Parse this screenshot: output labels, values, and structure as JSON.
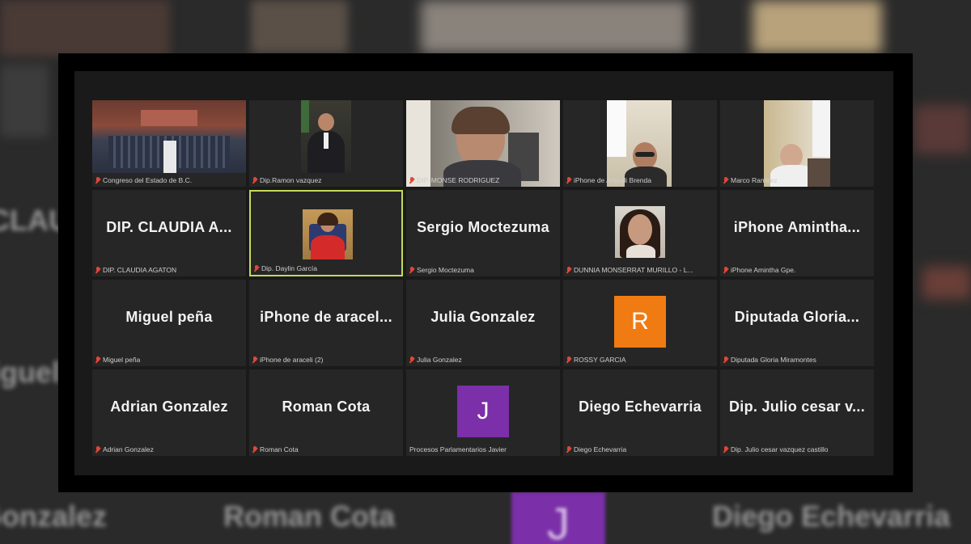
{
  "background": {
    "names": [
      "CLAUD",
      "Miguel",
      "Adrian Gonzalez",
      "Roman Cota",
      "Diego Echevarria"
    ]
  },
  "participants": [
    {
      "label": "Congreso del Estado de B.C.",
      "display_name": "",
      "type": "video-chamber"
    },
    {
      "label": "Dip.Ramon vazquez",
      "display_name": "",
      "type": "video-man"
    },
    {
      "label": "DIP. MONSE RODRIGUEZ",
      "display_name": "",
      "type": "video-woman"
    },
    {
      "label": "iPhone de Araceli Brenda",
      "display_name": "",
      "type": "video-woman2"
    },
    {
      "label": "Marco Ramirez",
      "display_name": "",
      "type": "video-man2"
    },
    {
      "label": "DIP. CLAUDIA AGATON",
      "display_name": "DIP. CLAUDIA A...",
      "type": "name"
    },
    {
      "label": "Dip. Daylin García",
      "display_name": "",
      "type": "video-daylin",
      "active": true
    },
    {
      "label": "Sergio Moctezuma",
      "display_name": "Sergio Moctezuma",
      "type": "name"
    },
    {
      "label": "DUNNIA MONSERRAT MURILLO - L...",
      "display_name": "",
      "type": "video-dunnia"
    },
    {
      "label": "iPhone Amintha Gpe.",
      "display_name": "iPhone Amintha...",
      "type": "name"
    },
    {
      "label": "Miguel peña",
      "display_name": "Miguel peña",
      "type": "name"
    },
    {
      "label": "iPhone de araceli (2)",
      "display_name": "iPhone de aracel...",
      "type": "name"
    },
    {
      "label": "Julia Gonzalez",
      "display_name": "Julia Gonzalez",
      "type": "name"
    },
    {
      "label": "ROSSY GARCIA",
      "display_name": "",
      "type": "avatar",
      "avatar_letter": "R",
      "avatar_color": "#f07b12"
    },
    {
      "label": "Diputada Gloria Miramontes",
      "display_name": "Diputada Gloria...",
      "type": "name"
    },
    {
      "label": "Adrian Gonzalez",
      "display_name": "Adrian Gonzalez",
      "type": "name"
    },
    {
      "label": "Roman Cota",
      "display_name": "Roman Cota",
      "type": "name"
    },
    {
      "label": "Procesos Parlamentarios Javier",
      "display_name": "",
      "type": "avatar",
      "avatar_letter": "J",
      "avatar_color": "#7b2fa8",
      "no_mic": true
    },
    {
      "label": "Diego Echevarria",
      "display_name": "Diego Echevarria",
      "type": "name"
    },
    {
      "label": "Dip. Julio cesar vazquez castillo",
      "display_name": "Dip. Julio cesar v...",
      "type": "name"
    }
  ],
  "colors": {
    "active_border": "#c7d95a",
    "muted_mic": "#e0473a"
  }
}
